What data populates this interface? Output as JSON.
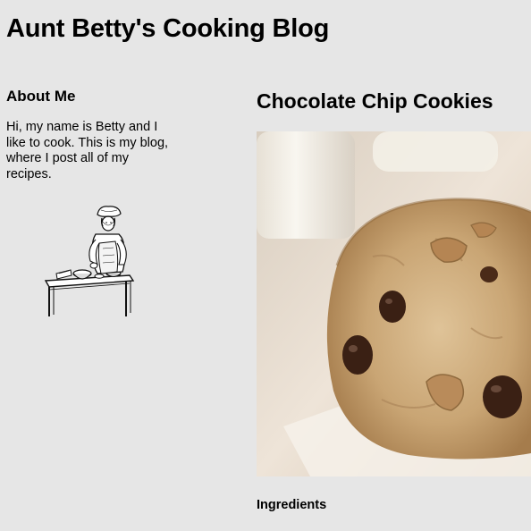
{
  "header": {
    "title": "Aunt Betty's Cooking Blog"
  },
  "sidebar": {
    "heading": "About Me",
    "text": "Hi, my name is Betty and I like to cook. This is my blog, where I post all of my recipes.",
    "illustration_icon": "chef-at-table-illustration"
  },
  "main": {
    "recipe_title": "Chocolate Chip Cookies",
    "photo_icon": "chocolate-chip-cookie-photo",
    "ingredients_heading": "Ingredients"
  },
  "colors": {
    "background": "#e6e6e6",
    "text": "#000000",
    "cookie": "#c9a574",
    "chocolate": "#3a2014"
  }
}
